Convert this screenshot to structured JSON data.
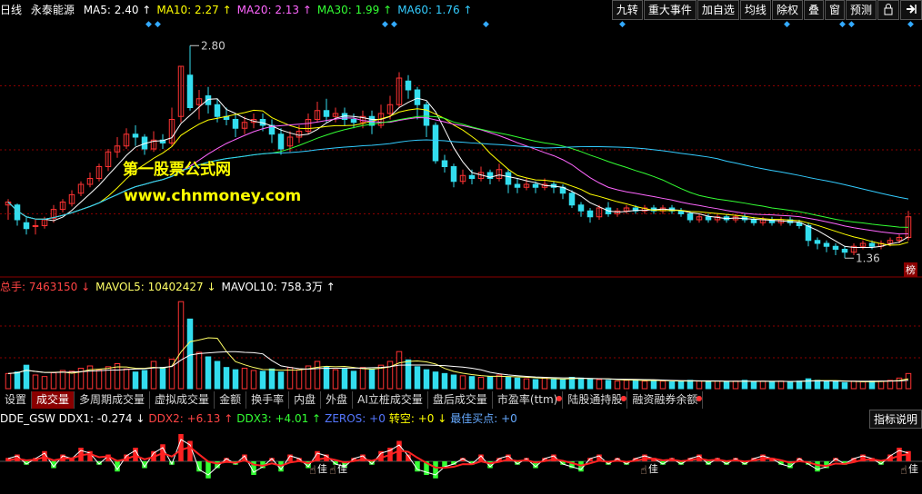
{
  "header": {
    "period": "日线",
    "stock_name": "永泰能源",
    "ma": [
      {
        "label": "MA5: 2.40",
        "color": "#ffffff",
        "arrow": "↑"
      },
      {
        "label": "MA10: 2.27",
        "color": "#ffff00",
        "arrow": "↑"
      },
      {
        "label": "MA20: 2.13",
        "color": "#ff66ff",
        "arrow": "↑"
      },
      {
        "label": "MA30: 1.99",
        "color": "#33ff33",
        "arrow": "↑"
      },
      {
        "label": "MA60: 1.76",
        "color": "#33ccff",
        "arrow": "↑"
      }
    ]
  },
  "toolbar": [
    "九转",
    "重大事件",
    "加自选",
    "均线",
    "除权",
    "叠",
    "窗",
    "预测"
  ],
  "toolbar_icons": {
    "lock": "lock-icon",
    "exit": "exit-arrow-icon"
  },
  "price_labels": {
    "high": "2.80",
    "low": "1.36"
  },
  "watermark": {
    "line1": "第一股票公式网",
    "line2": "www.chnmoney.com"
  },
  "badge": "榜",
  "volume_info": [
    {
      "label": "总手: 7463150",
      "color": "#ff4444",
      "arrow": "↓"
    },
    {
      "label": "MAVOL5: 10402427",
      "color": "#ffff66",
      "arrow": "↓"
    },
    {
      "label": "MAVOL10: 758.3万",
      "color": "#ffffff",
      "arrow": "↑"
    }
  ],
  "tabs": [
    {
      "label": "设置",
      "active": false,
      "dot": false
    },
    {
      "label": "成交量",
      "active": true,
      "dot": false
    },
    {
      "label": "多周期成交量",
      "active": false,
      "dot": false
    },
    {
      "label": "虚拟成交量",
      "active": false,
      "dot": false
    },
    {
      "label": "金额",
      "active": false,
      "dot": false
    },
    {
      "label": "换手率",
      "active": false,
      "dot": false
    },
    {
      "label": "内盘",
      "active": false,
      "dot": false
    },
    {
      "label": "外盘",
      "active": false,
      "dot": false
    },
    {
      "label": "AI立桩成交量",
      "active": false,
      "dot": false
    },
    {
      "label": "盘后成交量",
      "active": false,
      "dot": false
    },
    {
      "label": "市盈率(ttm)",
      "active": false,
      "dot": true
    },
    {
      "label": "陆股通持股",
      "active": false,
      "dot": true
    },
    {
      "label": "融资融券余额",
      "active": false,
      "dot": true
    }
  ],
  "ddx_info": [
    {
      "label": "DDE_GSW DDX1: -0.274",
      "color": "#ffffff",
      "arrow": "↓"
    },
    {
      "label": "DDX2: +6.13",
      "color": "#ff4444",
      "arrow": "↑"
    },
    {
      "label": "DDX3: +4.01",
      "color": "#33ff33",
      "arrow": "↑"
    },
    {
      "label": "ZEROS: +0",
      "color": "#5577ff",
      "arrow": ""
    },
    {
      "label": "转空: +0",
      "color": "#ffff00",
      "arrow": "↓"
    },
    {
      "label": "最佳买点: +0",
      "color": "#66aaff",
      "arrow": ""
    }
  ],
  "ddx_help": "指标说明",
  "ddx_marker_text": "佳",
  "colors": {
    "up": "#ff3333",
    "down": "#33ddee",
    "grid": "#8b0000"
  },
  "chart_data": {
    "type": "candlestick",
    "title": "",
    "ylim": [
      1.3,
      2.9
    ],
    "candles": [
      [
        1.72,
        1.74,
        1.76,
        1.62
      ],
      [
        1.72,
        1.62,
        1.73,
        1.58
      ],
      [
        1.6,
        1.56,
        1.64,
        1.52
      ],
      [
        1.58,
        1.58,
        1.62,
        1.52
      ],
      [
        1.58,
        1.62,
        1.64,
        1.56
      ],
      [
        1.63,
        1.69,
        1.72,
        1.6
      ],
      [
        1.69,
        1.74,
        1.76,
        1.67
      ],
      [
        1.73,
        1.79,
        1.82,
        1.71
      ],
      [
        1.8,
        1.86,
        1.88,
        1.78
      ],
      [
        1.86,
        1.9,
        1.94,
        1.84
      ],
      [
        1.9,
        1.98,
        2.0,
        1.88
      ],
      [
        1.98,
        2.08,
        2.1,
        1.95
      ],
      [
        2.08,
        2.12,
        2.18,
        2.04
      ],
      [
        2.12,
        2.2,
        2.24,
        2.1
      ],
      [
        2.2,
        2.18,
        2.26,
        2.12
      ],
      [
        2.18,
        2.1,
        2.2,
        2.06
      ],
      [
        2.1,
        2.16,
        2.22,
        2.08
      ],
      [
        2.16,
        2.14,
        2.2,
        2.1
      ],
      [
        2.14,
        2.3,
        2.38,
        2.12
      ],
      [
        2.32,
        2.66,
        2.66,
        2.28
      ],
      [
        2.6,
        2.38,
        2.8,
        2.36
      ],
      [
        2.4,
        2.44,
        2.5,
        2.3
      ],
      [
        2.46,
        2.4,
        2.52,
        2.34
      ],
      [
        2.4,
        2.32,
        2.44,
        2.28
      ],
      [
        2.32,
        2.3,
        2.38,
        2.26
      ],
      [
        2.3,
        2.24,
        2.34,
        2.18
      ],
      [
        2.24,
        2.28,
        2.32,
        2.2
      ],
      [
        2.28,
        2.3,
        2.34,
        2.24
      ],
      [
        2.3,
        2.26,
        2.34,
        2.22
      ],
      [
        2.26,
        2.2,
        2.3,
        2.14
      ],
      [
        2.2,
        2.1,
        2.24,
        2.06
      ],
      [
        2.12,
        2.18,
        2.22,
        2.08
      ],
      [
        2.18,
        2.22,
        2.26,
        2.14
      ],
      [
        2.22,
        2.3,
        2.34,
        2.2
      ],
      [
        2.3,
        2.36,
        2.42,
        2.28
      ],
      [
        2.36,
        2.32,
        2.44,
        2.28
      ],
      [
        2.32,
        2.34,
        2.38,
        2.28
      ],
      [
        2.34,
        2.3,
        2.38,
        2.26
      ],
      [
        2.3,
        2.28,
        2.34,
        2.24
      ],
      [
        2.28,
        2.32,
        2.36,
        2.24
      ],
      [
        2.32,
        2.26,
        2.36,
        2.2
      ],
      [
        2.26,
        2.34,
        2.4,
        2.24
      ],
      [
        2.34,
        2.4,
        2.46,
        2.3
      ],
      [
        2.4,
        2.58,
        2.62,
        2.38
      ],
      [
        2.56,
        2.5,
        2.6,
        2.44
      ],
      [
        2.5,
        2.4,
        2.52,
        2.3
      ],
      [
        2.4,
        2.26,
        2.42,
        2.18
      ],
      [
        2.26,
        2.02,
        2.28,
        2.0
      ],
      [
        2.02,
        1.98,
        2.06,
        1.94
      ],
      [
        1.98,
        1.88,
        2.0,
        1.84
      ],
      [
        1.88,
        1.92,
        1.96,
        1.86
      ],
      [
        1.92,
        1.9,
        1.96,
        1.86
      ],
      [
        1.9,
        1.94,
        1.98,
        1.88
      ],
      [
        1.94,
        1.9,
        1.96,
        1.86
      ],
      [
        1.9,
        1.96,
        2.0,
        1.88
      ],
      [
        1.94,
        1.86,
        1.96,
        1.8
      ],
      [
        1.86,
        1.84,
        1.9,
        1.8
      ],
      [
        1.84,
        1.86,
        1.9,
        1.82
      ],
      [
        1.86,
        1.84,
        1.88,
        1.8
      ],
      [
        1.84,
        1.86,
        1.9,
        1.82
      ],
      [
        1.86,
        1.84,
        1.88,
        1.8
      ],
      [
        1.84,
        1.8,
        1.86,
        1.76
      ],
      [
        1.8,
        1.72,
        1.82,
        1.7
      ],
      [
        1.72,
        1.68,
        1.74,
        1.64
      ],
      [
        1.68,
        1.64,
        1.7,
        1.6
      ],
      [
        1.64,
        1.7,
        1.72,
        1.62
      ],
      [
        1.7,
        1.66,
        1.74,
        1.64
      ],
      [
        1.66,
        1.68,
        1.7,
        1.64
      ],
      [
        1.68,
        1.7,
        1.72,
        1.66
      ],
      [
        1.7,
        1.68,
        1.72,
        1.66
      ],
      [
        1.68,
        1.7,
        1.72,
        1.66
      ],
      [
        1.7,
        1.68,
        1.72,
        1.66
      ],
      [
        1.68,
        1.7,
        1.72,
        1.66
      ],
      [
        1.7,
        1.68,
        1.72,
        1.66
      ],
      [
        1.68,
        1.66,
        1.7,
        1.64
      ],
      [
        1.66,
        1.62,
        1.68,
        1.6
      ],
      [
        1.62,
        1.64,
        1.66,
        1.6
      ],
      [
        1.64,
        1.62,
        1.66,
        1.6
      ],
      [
        1.62,
        1.64,
        1.66,
        1.6
      ],
      [
        1.64,
        1.62,
        1.66,
        1.6
      ],
      [
        1.62,
        1.64,
        1.66,
        1.6
      ],
      [
        1.64,
        1.62,
        1.66,
        1.6
      ],
      [
        1.62,
        1.6,
        1.64,
        1.58
      ],
      [
        1.6,
        1.62,
        1.64,
        1.58
      ],
      [
        1.62,
        1.6,
        1.64,
        1.58
      ],
      [
        1.6,
        1.62,
        1.64,
        1.58
      ],
      [
        1.62,
        1.6,
        1.64,
        1.58
      ],
      [
        1.6,
        1.58,
        1.62,
        1.56
      ],
      [
        1.58,
        1.48,
        1.6,
        1.44
      ],
      [
        1.48,
        1.46,
        1.5,
        1.42
      ],
      [
        1.46,
        1.44,
        1.48,
        1.4
      ],
      [
        1.44,
        1.42,
        1.46,
        1.38
      ],
      [
        1.42,
        1.4,
        1.44,
        1.36
      ],
      [
        1.4,
        1.44,
        1.46,
        1.38
      ],
      [
        1.44,
        1.46,
        1.48,
        1.42
      ],
      [
        1.46,
        1.44,
        1.48,
        1.42
      ],
      [
        1.44,
        1.46,
        1.48,
        1.42
      ],
      [
        1.46,
        1.48,
        1.5,
        1.44
      ],
      [
        1.48,
        1.5,
        1.52,
        1.46
      ],
      [
        1.5,
        1.64,
        1.68,
        1.48
      ]
    ],
    "ma_colors": [
      "#ffffff",
      "#ffff00",
      "#ff66ff",
      "#33ff33",
      "#33ccff"
    ],
    "ma_periods": [
      5,
      10,
      20,
      30,
      60
    ],
    "volume": [
      2,
      2.2,
      3.1,
      1.8,
      1.6,
      2.1,
      2.4,
      2.3,
      2.7,
      3.0,
      2.5,
      2.9,
      3.3,
      2.6,
      2.2,
      2.4,
      3.6,
      2.8,
      3.9,
      11.5,
      9.2,
      4.8,
      4.2,
      3.6,
      2.8,
      2.5,
      2.7,
      2.4,
      2.3,
      2.6,
      2.2,
      2.8,
      2.5,
      3.0,
      3.6,
      2.9,
      2.5,
      2.7,
      2.3,
      2.8,
      2.6,
      3.1,
      3.6,
      4.9,
      3.8,
      2.9,
      2.5,
      2.2,
      2.0,
      1.8,
      1.7,
      1.6,
      1.5,
      1.6,
      1.8,
      1.5,
      1.4,
      1.3,
      1.2,
      1.4,
      1.3,
      1.2,
      1.5,
      1.4,
      1.3,
      1.2,
      1.1,
      1.0,
      1.1,
      1.2,
      1.0,
      1.1,
      1.0,
      0.9,
      1.0,
      1.1,
      1.0,
      0.9,
      1.0,
      0.9,
      1.0,
      1.1,
      0.9,
      1.0,
      0.9,
      1.0,
      0.9,
      1.0,
      1.3,
      1.1,
      1.0,
      0.9,
      0.8,
      1.0,
      0.9,
      1.0,
      1.0,
      1.1,
      1.4,
      2.0
    ],
    "volume_ylim": [
      0,
      12
    ],
    "ddx": [
      1,
      2,
      -1,
      1,
      3,
      -2,
      2,
      1,
      4,
      3,
      -1,
      2,
      -3,
      2,
      4,
      -2,
      3,
      5,
      -1,
      8,
      6,
      -3,
      -5,
      -2,
      1,
      -1,
      2,
      -4,
      -2,
      1,
      -3,
      2,
      1,
      -2,
      3,
      2,
      -1,
      -2,
      1,
      2,
      -1,
      3,
      4,
      6,
      2,
      -3,
      -4,
      -5,
      -2,
      -1,
      1,
      -1,
      2,
      -2,
      1,
      2,
      -1,
      1,
      -2,
      1,
      2,
      -1,
      -2,
      -3,
      1,
      2,
      -1,
      1,
      -1,
      1,
      2,
      1,
      -1,
      1,
      -1,
      1,
      2,
      -1,
      1,
      -1,
      1,
      -1,
      1,
      2,
      1,
      -1,
      -2,
      1,
      -1,
      -3,
      -2,
      1,
      -1,
      1,
      2,
      1,
      -1,
      2,
      4,
      3
    ],
    "ddx_ylim": [
      -8,
      8
    ]
  }
}
